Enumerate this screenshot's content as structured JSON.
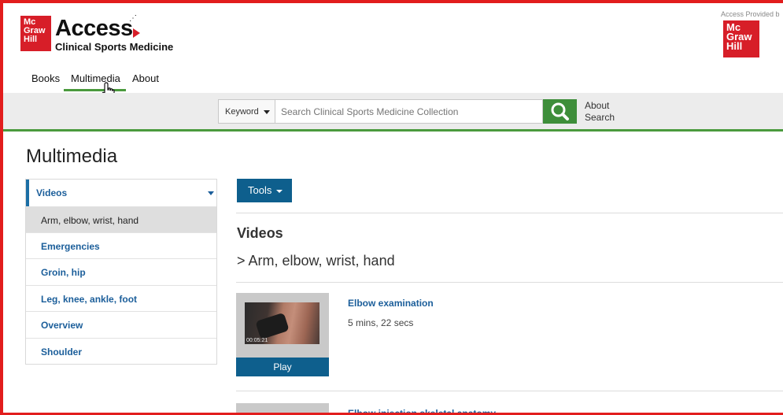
{
  "brand": {
    "logo_lines": [
      "Mc",
      "Graw",
      "Hill"
    ],
    "access": "Access",
    "product": "Clinical Sports Medicine",
    "provided_by": "Access Provided b",
    "colors": {
      "brand_red": "#d71e28",
      "accent_green": "#4a9a3d",
      "link_blue": "#1b5e9a",
      "button_blue": "#0e5f8d"
    }
  },
  "nav": {
    "items": [
      {
        "label": "Books"
      },
      {
        "label": "Multimedia",
        "active": true
      },
      {
        "label": "About"
      }
    ],
    "cursor_icon": "hand-pointer-icon"
  },
  "search": {
    "keyword_label": "Keyword",
    "placeholder": "Search Clinical Sports Medicine Collection",
    "value": "",
    "about_line1": "About",
    "about_line2": "Search",
    "button_icon": "search-icon"
  },
  "page": {
    "title": "Multimedia"
  },
  "sidebar": {
    "header": "Videos",
    "items": [
      {
        "label": "Arm, elbow, wrist, hand",
        "active": true
      },
      {
        "label": "Emergencies"
      },
      {
        "label": "Groin, hip"
      },
      {
        "label": "Leg, knee, ankle, foot"
      },
      {
        "label": "Overview"
      },
      {
        "label": "Shoulder"
      }
    ]
  },
  "main": {
    "tools_label": "Tools",
    "section_title": "Videos",
    "breadcrumb": "> Arm, elbow, wrist, hand",
    "videos": [
      {
        "title": "Elbow examination",
        "duration": "5 mins, 22 secs",
        "timestamp": "00:05:21",
        "play_label": "Play"
      },
      {
        "title": "Elbow injection skeletal anatomy"
      }
    ]
  }
}
